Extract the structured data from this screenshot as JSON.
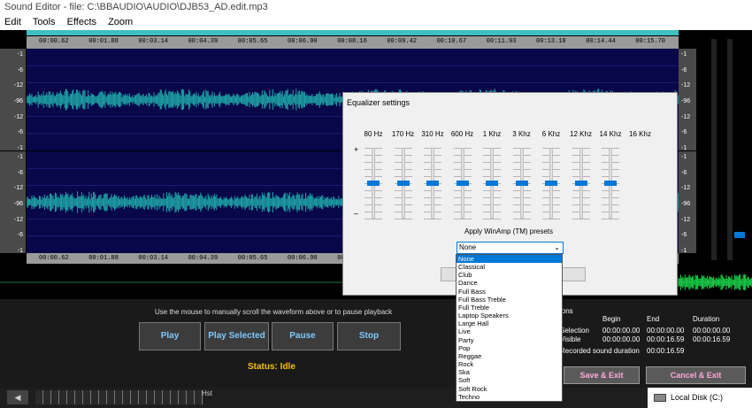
{
  "window": {
    "title": "Sound Editor - file: C:\\BBAUDIO\\AUDIO\\DJB53_AD.edit.mp3"
  },
  "menu": [
    {
      "label": "Edit"
    },
    {
      "label": "Tools"
    },
    {
      "label": "Effects"
    },
    {
      "label": "Zoom"
    }
  ],
  "ruler_ticks": [
    "00:00.62",
    "00:01.88",
    "00:03.14",
    "00:04.39",
    "00:05.65",
    "00:06.90",
    "00:08.16",
    "00:09.42",
    "00:10.67",
    "00:11.93",
    "00:13.18",
    "00:14.44",
    "00:15.70"
  ],
  "y_axis_labels": [
    "-1",
    "-6",
    "-12",
    "-96",
    "-12",
    "-6",
    "-1"
  ],
  "hint": "Use the mouse to manually scroll the waveform above or to pause playback",
  "buttons": {
    "play": "Play",
    "play_selected": "Play Selected",
    "pause": "Pause",
    "stop": "Stop"
  },
  "status": "Status: Idle",
  "info": {
    "header": "ions",
    "cols": [
      "Begin",
      "End",
      "Duration"
    ],
    "rows": [
      {
        "label": "Selection",
        "begin": "00:00:00.00",
        "end": "00:00:00.00",
        "duration": "00:00:00.00"
      },
      {
        "label": "Visible",
        "begin": "00:00:00.00",
        "end": "00:00:16.59",
        "duration": "00:00:16.59"
      }
    ],
    "recorded_label": "Recorded sound duration",
    "recorded_value": "00:00:16.59"
  },
  "save_exit": "Save & Exit",
  "cancel_exit": "Cancel & Exit",
  "bottom": {
    "hst": "Hst",
    "disk": "Local Disk (C:)"
  },
  "equalizer": {
    "title": "Equalizer settings",
    "plus": "+",
    "minus": "–",
    "bands": [
      "80 Hz",
      "170 Hz",
      "310 Hz",
      "600 Hz",
      "1 Khz",
      "3 Khz",
      "6 Khz",
      "12 Khz",
      "14 Khz",
      "16 Khz"
    ],
    "presets_label": "Apply WinAmp (TM) presets",
    "selected": "None",
    "options": [
      "None",
      "Classical",
      "Club",
      "Dance",
      "Full Bass",
      "Full Bass Treble",
      "Full Treble",
      "Laptop Speakers",
      "Large Hall",
      "Live",
      "Party",
      "Pop",
      "Reggae",
      "Rock",
      "Ska",
      "Soft",
      "Soft Rock",
      "Techno"
    ]
  },
  "colors": {
    "waveform": "#1fa8a8",
    "track_bg": "#07074a",
    "status": "#f2c200",
    "accent": "#0078d7"
  }
}
